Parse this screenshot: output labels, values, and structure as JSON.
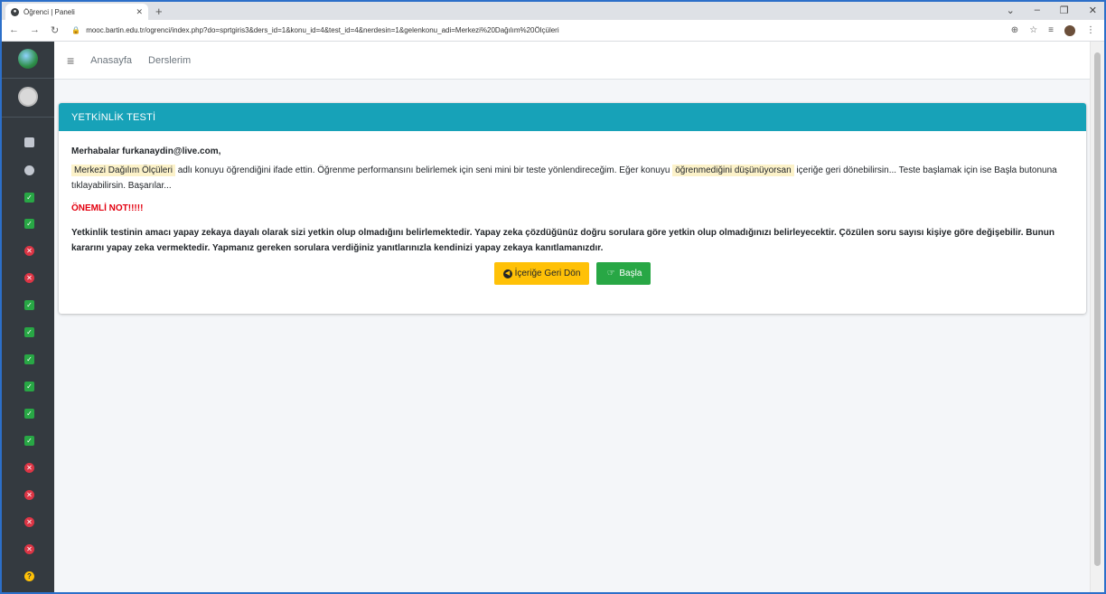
{
  "browser": {
    "tab_title": "Öğrenci | Paneli",
    "new_tab": "+",
    "url": "mooc.bartin.edu.tr/ogrenci/index.php?do=sprtgiris3&ders_id=1&konu_id=4&test_id=4&nerdesin=1&gelenkonu_adi=Merkezi%20Dağılım%20Ölçüleri"
  },
  "nav": {
    "home": "Anasayfa",
    "courses": "Derslerim"
  },
  "sidebar": {
    "items": [
      "doc-icon",
      "gauge-icon",
      "check",
      "check",
      "x",
      "x",
      "check",
      "check",
      "check",
      "check",
      "check",
      "check",
      "x",
      "x",
      "x",
      "x",
      "question"
    ]
  },
  "card": {
    "title": "YETKİNLİK TESTİ",
    "greeting": "Merhabalar furkanaydin@live.com,",
    "topic": "Merkezi Dağılım Ölçüleri",
    "text1": " adlı konuyu öğrendiğini ifade ettin. Öğrenme performansını belirlemek için seni mini bir teste yönlendireceğim. Eğer konuyu ",
    "highlight2": "öğrenmediğini düşünüyorsan",
    "text2": " içeriğe geri dönebilirsin... Teste başlamak için ise Başla butonuna tıklayabilirsin. Başarılar...",
    "note": "ÖNEMLİ NOT!!!!!",
    "paragraph": "Yetkinlik testinin amacı yapay zekaya dayalı olarak sizi yetkin olup olmadığını belirlemektedir. Yapay zeka çözdüğünüz doğru sorulara göre yetkin olup olmadığınızı belirleyecektir. Çözülen soru sayısı kişiye göre değişebilir. Bunun kararını yapay zeka vermektedir. Yapmanız gereken sorulara verdiğiniz yanıtlarınızla kendinizi yapay zekaya kanıtlamanızdır.",
    "back_button": "İçeriğe Geri Dön",
    "start_button": "Başla"
  },
  "colors": {
    "header": "#17a2b8",
    "sidebar": "#343a40",
    "warning": "#ffc107",
    "success": "#28a745",
    "danger": "#dc3545"
  }
}
